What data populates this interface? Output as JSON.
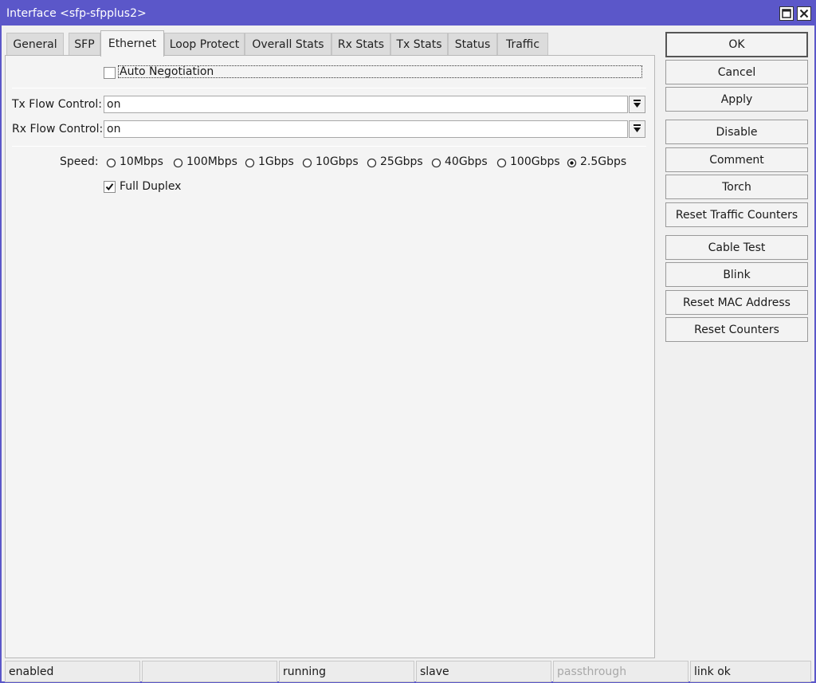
{
  "window": {
    "title": "Interface <sfp-sfpplus2>",
    "title_color": "#5b57c9"
  },
  "tabs": [
    {
      "label": "General"
    },
    {
      "label": "SFP"
    },
    {
      "label": "Ethernet",
      "active": true
    },
    {
      "label": "Loop Protect"
    },
    {
      "label": "Overall Stats"
    },
    {
      "label": "Rx Stats"
    },
    {
      "label": "Tx Stats"
    },
    {
      "label": "Status"
    },
    {
      "label": "Traffic"
    }
  ],
  "ethernet": {
    "auto_negotiation": {
      "label": "Auto Negotiation",
      "checked": false
    },
    "tx_flow_control": {
      "label": "Tx Flow Control:",
      "value": "on"
    },
    "rx_flow_control": {
      "label": "Rx Flow Control:",
      "value": "on"
    },
    "speed": {
      "label": "Speed:",
      "options": [
        "10Mbps",
        "100Mbps",
        "1Gbps",
        "10Gbps",
        "25Gbps",
        "40Gbps",
        "100Gbps",
        "2.5Gbps"
      ],
      "selected": "2.5Gbps"
    },
    "full_duplex": {
      "label": "Full Duplex",
      "checked": true
    }
  },
  "buttons": {
    "ok": "OK",
    "cancel": "Cancel",
    "apply": "Apply",
    "disable": "Disable",
    "comment": "Comment",
    "torch": "Torch",
    "reset_traffic_counters": "Reset Traffic Counters",
    "cable_test": "Cable Test",
    "blink": "Blink",
    "reset_mac_address": "Reset MAC Address",
    "reset_counters": "Reset Counters"
  },
  "status_bar": [
    "enabled",
    "",
    "running",
    "slave",
    "passthrough",
    "link ok"
  ]
}
